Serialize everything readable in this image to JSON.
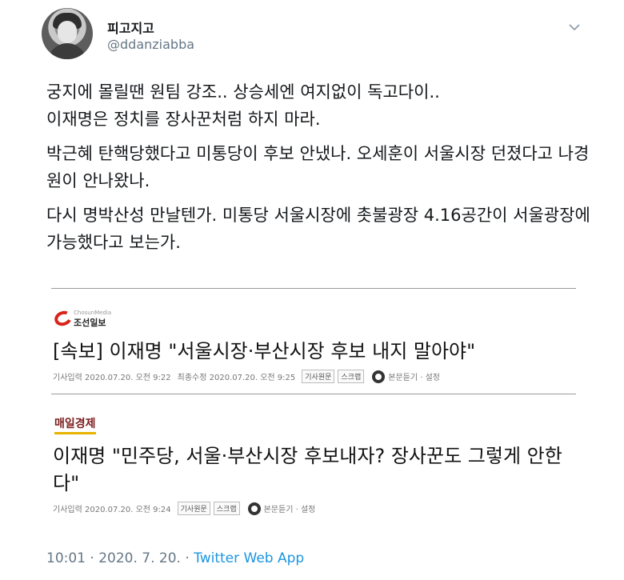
{
  "user": {
    "display_name": "피고지고",
    "handle": "@ddanziabba"
  },
  "tweet": {
    "paragraphs": [
      "궁지에 몰릴땐 원팀 강조.. 상승세엔 여지없이 독고다이..\n이재명은 정치를 장사꾼처럼 하지 마라.",
      "박근혜 탄핵당했다고 미통당이 후보 안냈나. 오세훈이 서울시장 던졌다고 나경원이 안나왔나.",
      "다시 명박산성 만날텐가. 미통당 서울시장에 촛불광장 4.16공간이 서울광장에 가능했다고 보는가."
    ]
  },
  "clips": [
    {
      "outlet_small": "ChosunMedia",
      "outlet": "조선일보",
      "headline": "[속보] 이재명 \"서울시장·부산시장 후보 내지 말아야\"",
      "input_time": "기사입력 2020.07.20. 오전 9:22",
      "edit_time": "최종수정 2020.07.20. 오전 9:25",
      "btn_original": "기사원문",
      "btn_scrap": "스크랩",
      "listen": "본문듣기 · 설정"
    },
    {
      "outlet": "매일경제",
      "headline": "이재명 \"민주당, 서울·부산시장 후보내자? 장사꾼도 그렇게 안한다\"",
      "input_time": "기사입력 2020.07.20. 오전 9:24",
      "btn_original": "기사원문",
      "btn_scrap": "스크랩",
      "listen": "본문듣기 · 설정"
    }
  ],
  "footer": {
    "timestamp": "10:01 · 2020. 7. 20. · ",
    "app": "Twitter Web App"
  },
  "icons": {
    "menu": "chevron-down-icon",
    "listen": "speaker-icon"
  },
  "colors": {
    "link": "#1b95e0",
    "secondary": "#657786",
    "chosun_red": "#d9221a"
  }
}
